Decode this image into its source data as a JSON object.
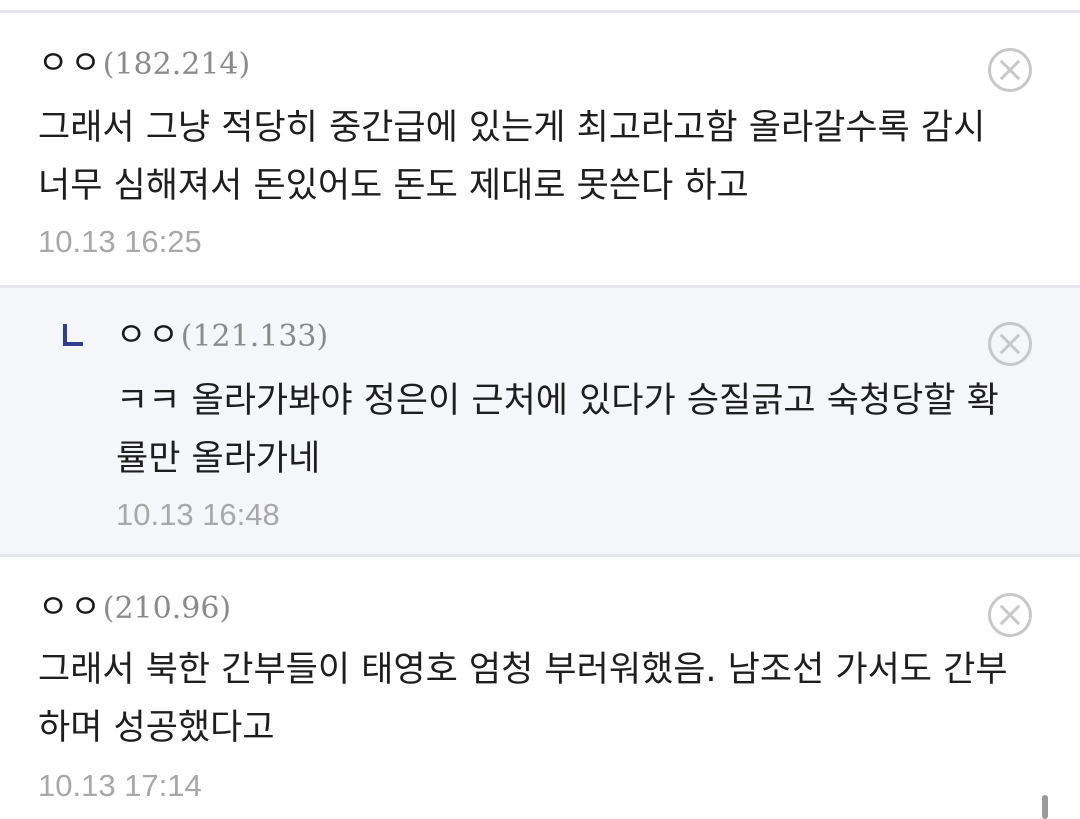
{
  "comments": [
    {
      "nickname": "ㅇㅇ",
      "ip": "(182.214)",
      "lines": [
        "그래서 그냥 적당히 중간급에 있는게 최고라고함 올라갈수록 감시",
        "너무 심해져서 돈있어도 돈도 제대로 못쓴다 하고"
      ],
      "timestamp": "10.13 16:25"
    },
    {
      "nickname": "ㅇㅇ",
      "ip": "(121.133)",
      "lines": [
        "ㅋㅋ 올라가봐야 정은이 근처에 있다가 승질긁고 숙청당할 확",
        "률만 올라가네"
      ],
      "timestamp": "10.13 16:48"
    },
    {
      "nickname": "ㅇㅇ",
      "ip": "(210.96)",
      "lines": [
        "그래서 북한 간부들이 태영호 엄청 부러워했음. 남조선 가서도 간부",
        "하며 성공했다고"
      ],
      "timestamp": "10.13 17:14"
    }
  ],
  "icons": {
    "delete": "close-circle-icon",
    "reply": "reply-arrow-icon"
  },
  "colors": {
    "reply_accent": "#2e3f8f",
    "reply_background": "#f5f6f9",
    "ip_text": "#8b8b8b",
    "timestamp_text": "#a8a8a8"
  }
}
